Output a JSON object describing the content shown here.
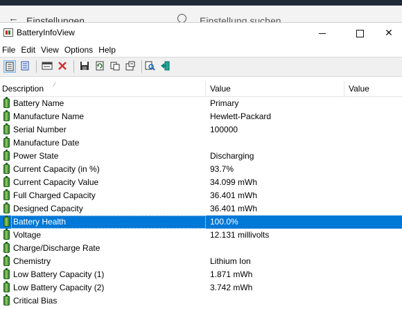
{
  "background_window": {
    "title": "Einstellungen",
    "search_placeholder": "Einstellung suchen"
  },
  "window": {
    "title": "BatteryInfoView"
  },
  "menu": [
    "File",
    "Edit",
    "View",
    "Options",
    "Help"
  ],
  "toolbar": {
    "buttons": [
      "view-list",
      "view-html",
      "properties",
      "delete",
      "save",
      "refresh",
      "copy",
      "options",
      "find",
      "exit"
    ]
  },
  "columns": {
    "description": "Description",
    "value": "Value",
    "value2": "Value"
  },
  "rows": [
    {
      "label": "Battery Name",
      "value": "Primary"
    },
    {
      "label": "Manufacture Name",
      "value": "Hewlett-Packard"
    },
    {
      "label": "Serial Number",
      "value": "100000"
    },
    {
      "label": "Manufacture Date",
      "value": ""
    },
    {
      "label": "Power State",
      "value": "Discharging"
    },
    {
      "label": "Current Capacity (in %)",
      "value": "93.7%"
    },
    {
      "label": "Current Capacity Value",
      "value": "34.099 mWh"
    },
    {
      "label": "Full Charged Capacity",
      "value": "36.401 mWh"
    },
    {
      "label": "Designed Capacity",
      "value": "36.401 mWh"
    },
    {
      "label": "Battery Health",
      "value": "100.0%"
    },
    {
      "label": "Voltage",
      "value": "12.131 millivolts"
    },
    {
      "label": "Charge/Discharge Rate",
      "value": ""
    },
    {
      "label": "Chemistry",
      "value": "Lithium Ion"
    },
    {
      "label": "Low Battery Capacity (1)",
      "value": "1.871 mWh"
    },
    {
      "label": "Low Battery Capacity (2)",
      "value": "3.742 mWh"
    },
    {
      "label": "Critical Bias",
      "value": ""
    }
  ],
  "selected_row": 9,
  "colors": {
    "selection": "#0078d7",
    "toolbar_bg": "#f0f0f0"
  }
}
